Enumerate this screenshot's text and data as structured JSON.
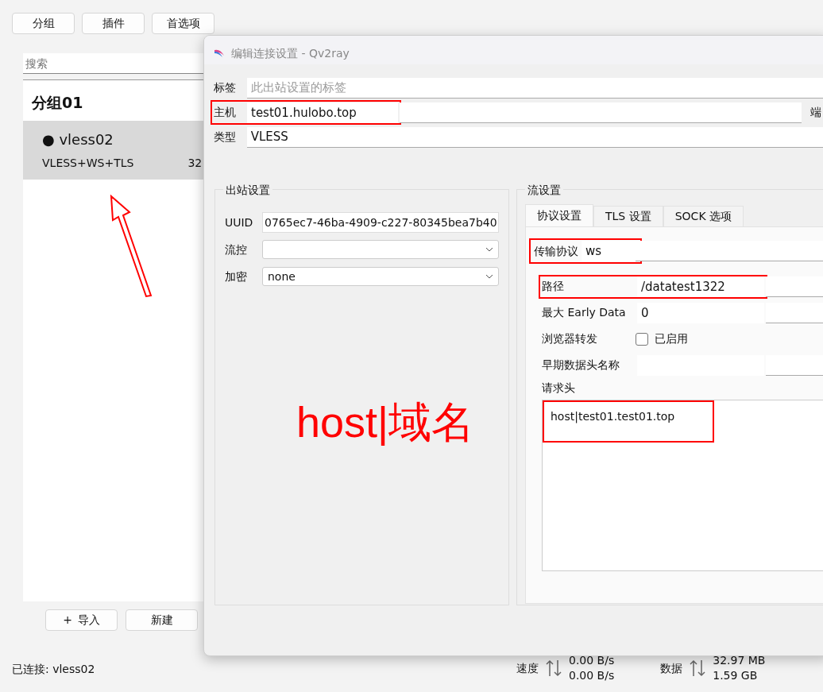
{
  "toolbar": [
    "分组",
    "插件",
    "首选项"
  ],
  "search": {
    "placeholder": "搜索"
  },
  "group": {
    "title": "分组01",
    "items": [
      {
        "name": "● vless02",
        "type": "VLESS+WS+TLS",
        "extra": "32",
        "selected": true
      }
    ]
  },
  "bottom_buttons": [
    {
      "icon": "+",
      "label": "导入"
    },
    {
      "label": "新建"
    }
  ],
  "status_bar": {
    "connected": "已连接: vless02",
    "speed_label": "速度",
    "speed_up": "0.00 B/s",
    "speed_down": "0.00 B/s",
    "data_label": "数据",
    "data_up": "32.97 MB",
    "data_down": "1.59 GB"
  },
  "dialog": {
    "title": "编辑连接设置 - Qv2ray",
    "tag": {
      "label": "标签",
      "placeholder": "此出站设置的标签"
    },
    "host": {
      "label": "主机",
      "value": "test01.hulobo.top",
      "highlighted": true
    },
    "port_label": "端",
    "type": {
      "label": "类型",
      "value": "VLESS"
    },
    "outbound": {
      "title": "出站设置",
      "rows": [
        {
          "kind": "text",
          "label": "UUID",
          "value": "0765ec7-46ba-4909-c227-80345bea7b40"
        },
        {
          "kind": "select",
          "label": "流控",
          "value": ""
        },
        {
          "kind": "select",
          "label": "加密",
          "value": "none"
        }
      ]
    },
    "stream": {
      "title": "流设置",
      "tabs": [
        {
          "label": "协议设置",
          "selected": true
        },
        {
          "label": "TLS 设置",
          "selected": false
        },
        {
          "label": "SOCK 选项",
          "selected": false
        }
      ],
      "transport": {
        "label": "传输协议",
        "value": "ws",
        "highlighted": true
      },
      "rows": [
        {
          "kind": "text",
          "label": "路径",
          "value": "/datatest1322",
          "highlighted": true
        },
        {
          "kind": "text",
          "label": "最大 Early Data",
          "value": "0",
          "highlighted": false
        },
        {
          "kind": "check",
          "label": "浏览器转发",
          "value": "已启用",
          "checked": false,
          "highlighted": false
        },
        {
          "kind": "text",
          "label": "早期数据头名称",
          "value": "",
          "highlighted": false
        }
      ],
      "headers_label": "请求头",
      "headers": "host|test01.test01.top",
      "headers_highlighted": true
    }
  },
  "annotation": {
    "text": "host|域名"
  }
}
